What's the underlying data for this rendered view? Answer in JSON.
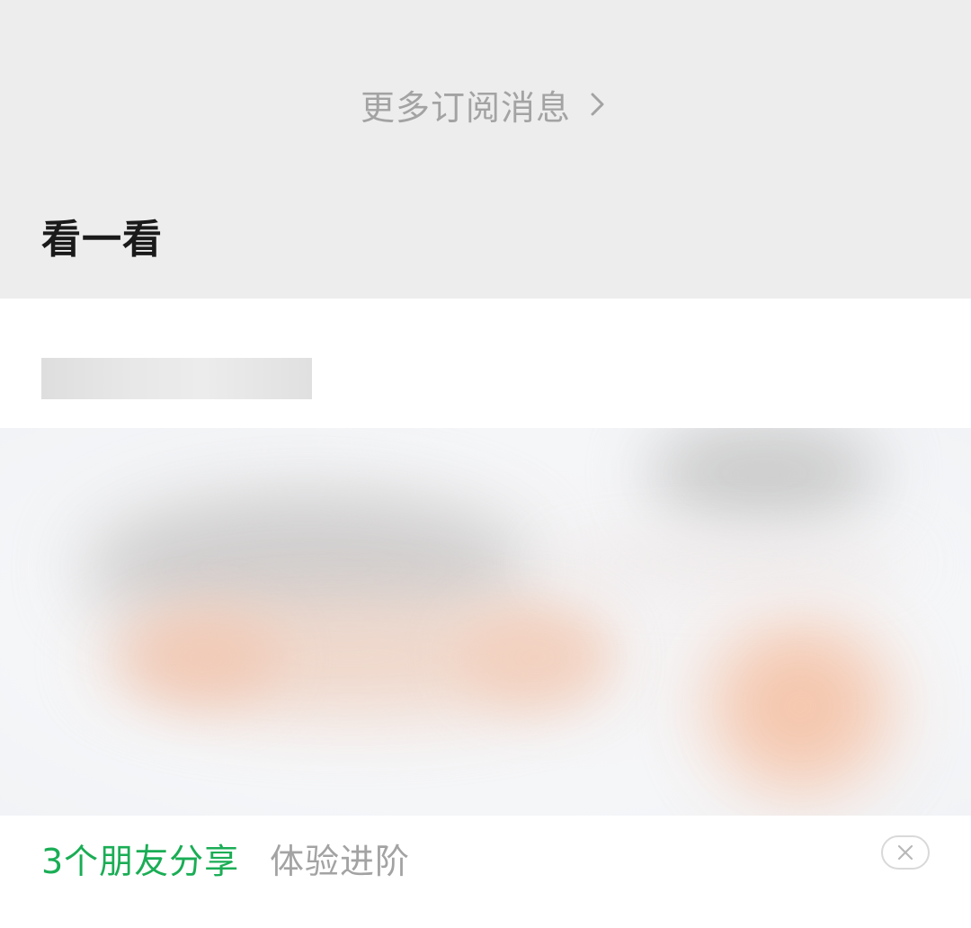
{
  "subscriptions": {
    "more_label": "更多订阅消息"
  },
  "discover": {
    "section_title": "看一看"
  },
  "article": {
    "shared_by": "3个朋友分享",
    "tag": "体验进阶"
  },
  "colors": {
    "background_gray": "#ededed",
    "accent_green": "#1aad55",
    "muted_text": "#a3a3a3"
  },
  "icons": {
    "more": "chevron-right-icon",
    "dismiss": "close-icon"
  }
}
